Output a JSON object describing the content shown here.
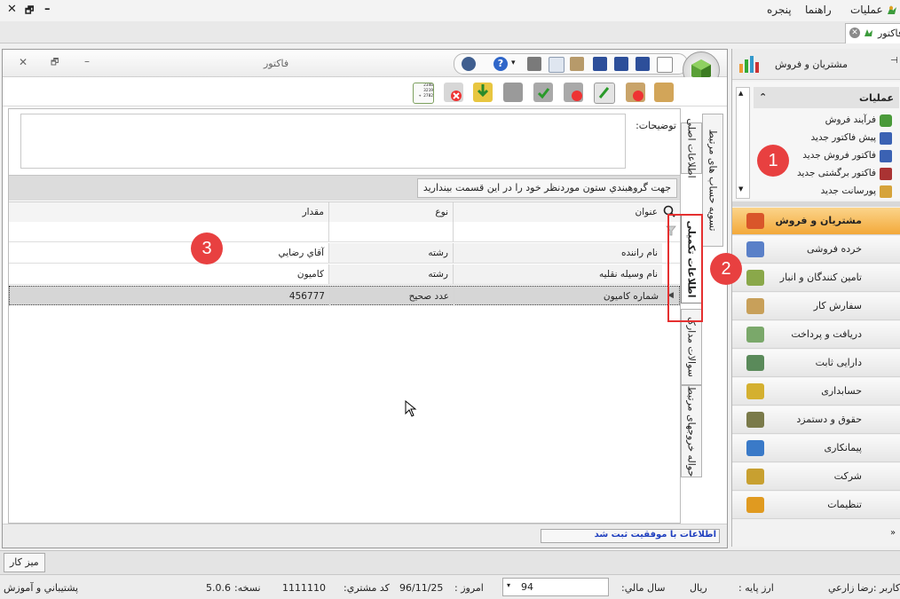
{
  "menubar": {
    "items": [
      "عملیات",
      "راهنما",
      "پنجره"
    ],
    "window_controls": [
      "✕",
      "🗗",
      "–"
    ]
  },
  "doc_tab": {
    "title": "فاکتور"
  },
  "document": {
    "title": "فاکتور",
    "description_label": "توضیحات:",
    "group_hint": "جهت گروهبندي ستون موردنظر خود را در اين قسمت بينداريد",
    "columns": [
      "عنوان",
      "نوع",
      "مقدار"
    ],
    "rows": [
      {
        "title": "نام راننده",
        "type": "رشته",
        "value": "آقاي رضايي"
      },
      {
        "title": "نام وسیله نقلیه",
        "type": "رشته",
        "value": "کامیون"
      },
      {
        "title": "شماره کامیون",
        "type": "عدد صحیح",
        "value": "456777"
      }
    ],
    "vertical_tabs": [
      "اطلاعات اصلی",
      "اطلاعات تکمیلی",
      "سوالات مدارک",
      "حواله خروجهای مرتبط"
    ],
    "vertical_tabs_far": [
      "تسویه حساب های مرتبط"
    ],
    "status_message": "اطلاعات با موفقیت ثبت شد",
    "calc_icon_lines": [
      "2346",
      "3219",
      "+ 2782"
    ]
  },
  "right_panel": {
    "header_title": "مشتریان و فروش",
    "pin_icon": "pin-icon",
    "ops_title": "عملیات",
    "ops_items": [
      "فرآیند فروش",
      "پیش فاکتور جدید",
      "فاکتور فروش جدید",
      "فاکتور برگشتی جدید",
      "پورسانت جدید"
    ],
    "nav_items": [
      {
        "label": "مشتریان و فروش",
        "active": true
      },
      {
        "label": "خرده فروشی",
        "active": false
      },
      {
        "label": "تامین کنندگان و انبار",
        "active": false
      },
      {
        "label": "سفارش کار",
        "active": false
      },
      {
        "label": "دریافت و پرداخت",
        "active": false
      },
      {
        "label": "دارایی ثابت",
        "active": false
      },
      {
        "label": "حسابداری",
        "active": false
      },
      {
        "label": "حقوق و دستمزد",
        "active": false
      },
      {
        "label": "پیمانکاری",
        "active": false
      },
      {
        "label": "شرکت",
        "active": false
      },
      {
        "label": "تنظیمات",
        "active": false
      }
    ]
  },
  "taskbar": {
    "desktop_button": "میز کار"
  },
  "statusbar": {
    "user": "نام کاربر :رضا زارعي",
    "currency_label": "ارز پایه :",
    "currency": "ریال",
    "fiscal_year_label": "سال مالي:",
    "fiscal_year": "94",
    "today_label": "امروز :",
    "today": "96/11/25",
    "customer_code_label": "کد مشتري:",
    "customer_code": "1111110",
    "version_label": "نسخه:",
    "version": "5.0.6",
    "support": "پشتيباني و آموزش"
  },
  "annotations": [
    "1",
    "2",
    "3"
  ],
  "colors": {
    "accent_orange": "#f7b64a",
    "badge_red": "#e84040",
    "highlight_red": "#e53030",
    "status_blue": "#1f3fbf"
  }
}
